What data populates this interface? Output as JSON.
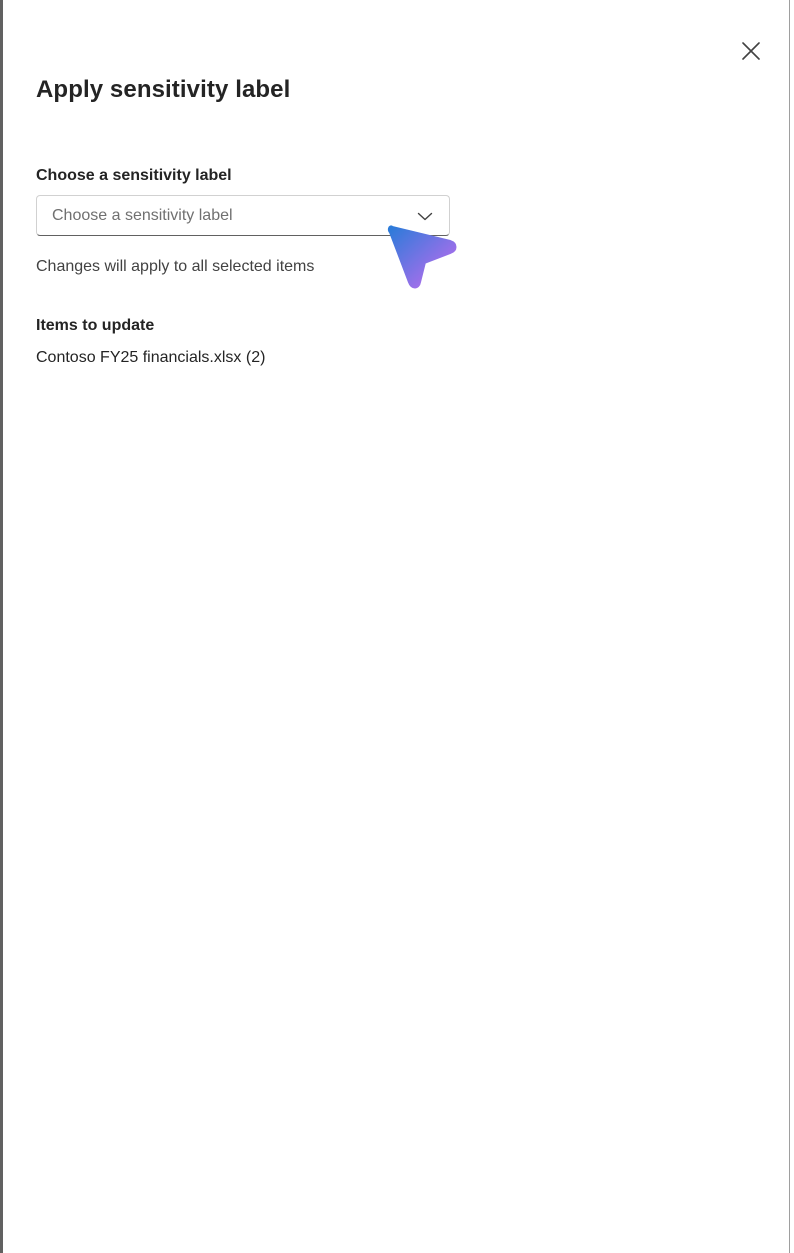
{
  "panel": {
    "title": "Apply sensitivity label",
    "close_icon": "close-icon"
  },
  "label_field": {
    "label": "Choose a sensitivity label",
    "placeholder": "Choose a sensitivity label",
    "chevron_icon": "chevron-down-icon",
    "helper_text": "Changes will apply to all selected items"
  },
  "items": {
    "heading": "Items to update",
    "list": [
      "Contoso FY25 financials.xlsx (2)"
    ]
  },
  "cursor": {
    "icon": "pointer-cursor-icon",
    "gradient_start": "#2b7bd9",
    "gradient_end": "#c86bf0"
  }
}
